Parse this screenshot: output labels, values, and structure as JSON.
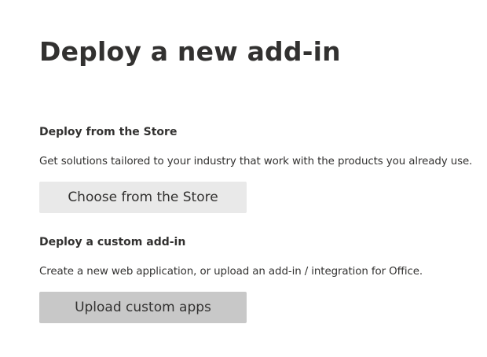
{
  "page": {
    "title": "Deploy a new add-in"
  },
  "store_section": {
    "heading": "Deploy from the Store",
    "description": "Get solutions tailored to your industry that work with the products you already use.",
    "button_label": "Choose from the Store"
  },
  "custom_section": {
    "heading": "Deploy a custom add-in",
    "description": "Create a new web application, or upload an add-in / integration for Office.",
    "button_label": "Upload custom apps"
  }
}
